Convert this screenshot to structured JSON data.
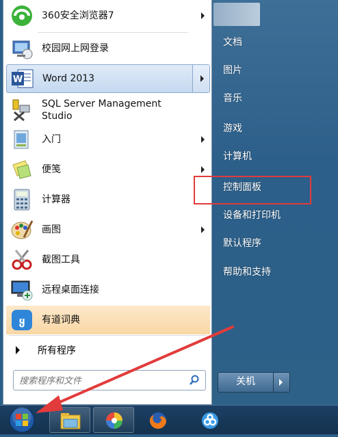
{
  "start_menu": {
    "pinned_items": [
      {
        "label": "360安全浏览器7",
        "icon": "360-browser-icon",
        "has_submenu": true
      },
      {
        "label": "校园网上网登录",
        "icon": "network-login-icon",
        "has_submenu": false
      },
      {
        "label": "Word 2013",
        "icon": "word-icon",
        "has_submenu": true,
        "selected": true
      },
      {
        "label": "SQL Server Management\nStudio",
        "icon": "sql-server-icon",
        "has_submenu": false
      },
      {
        "label": "入门",
        "icon": "getting-started-icon",
        "has_submenu": true
      },
      {
        "label": "便笺",
        "icon": "sticky-notes-icon",
        "has_submenu": true
      },
      {
        "label": "计算器",
        "icon": "calculator-icon",
        "has_submenu": false
      },
      {
        "label": "画图",
        "icon": "paint-icon",
        "has_submenu": true
      },
      {
        "label": "截图工具",
        "icon": "snipping-tool-icon",
        "has_submenu": false
      },
      {
        "label": "远程桌面连接",
        "icon": "remote-desktop-icon",
        "has_submenu": false
      },
      {
        "label": "有道词典",
        "icon": "youdao-dict-icon",
        "has_submenu": false,
        "highlight": true
      }
    ],
    "all_programs_label": "所有程序",
    "search_placeholder": "搜索程序和文件",
    "right_items": [
      "文档",
      "图片",
      "音乐",
      "游戏",
      "计算机",
      "控制面板",
      "设备和打印机",
      "默认程序",
      "帮助和支持"
    ],
    "shutdown_label": "关机"
  },
  "colors": {
    "right_panel": "#2d6188",
    "highlight_orange": "#f9d7a6",
    "selected_blue": "#c5d9f0",
    "annotation_red": "#e23b3b"
  },
  "taskbar": {
    "buttons": [
      "file-explorer-icon",
      "pinwheel-app-icon",
      "firefox-icon",
      "baidu-cloud-icon"
    ]
  }
}
